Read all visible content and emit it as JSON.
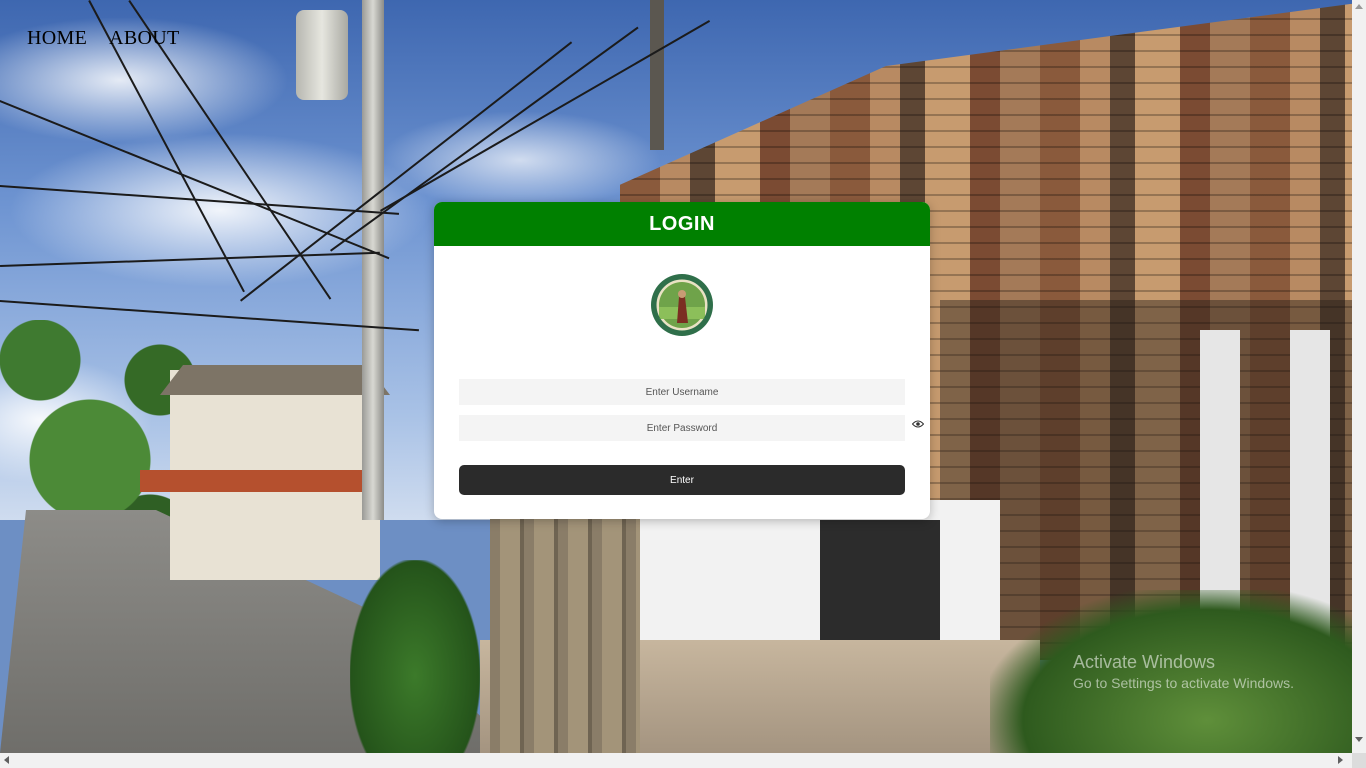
{
  "nav": {
    "home": "HOME",
    "about": "ABOUT"
  },
  "login": {
    "title": "LOGIN",
    "username_placeholder": "Enter Username",
    "password_placeholder": "Enter Password",
    "enter_label": "Enter",
    "show_password_icon": "eye-icon"
  },
  "watermark": {
    "title": "Activate Windows",
    "subtitle": "Go to Settings to activate Windows."
  },
  "colors": {
    "header": "#008000",
    "button": "#2b2b2b"
  }
}
